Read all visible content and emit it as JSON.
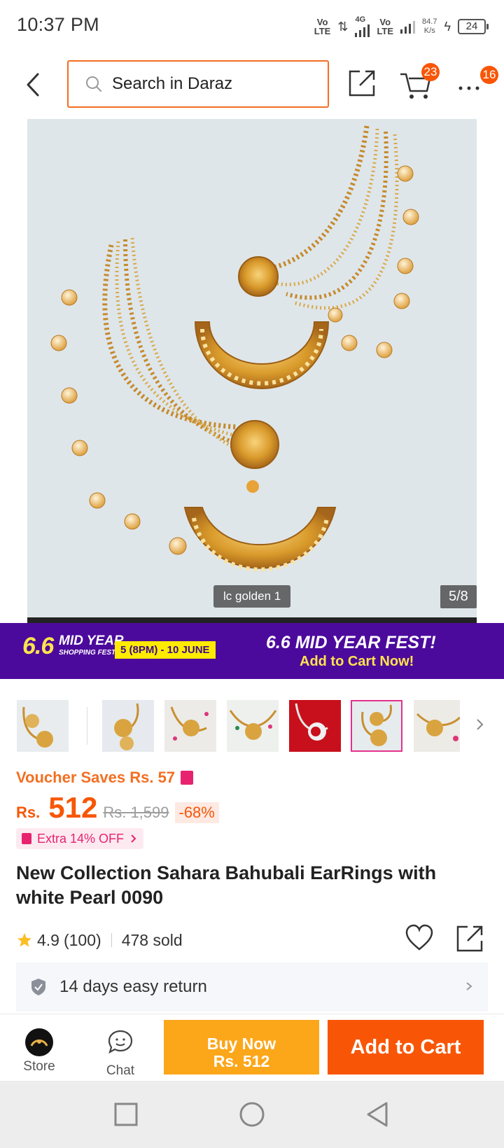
{
  "status_bar": {
    "time": "10:37 PM",
    "net1": "Vo\nLTE",
    "net2_gen": "4G",
    "net3": "Vo\nLTE",
    "speed_value": "84.7",
    "speed_unit": "K/s",
    "battery": "24"
  },
  "header": {
    "search_placeholder": "Search in Daraz",
    "cart_count": "23",
    "more_count": "16",
    "icons": [
      "back-arrow-icon",
      "search-icon",
      "share-icon",
      "cart-icon",
      "more-icon"
    ]
  },
  "gallery": {
    "caption": "lc golden 1",
    "counter": "5/8",
    "background": "#dfe6ea"
  },
  "banner": {
    "logo_number": "6.6",
    "logo_title": "MID YEAR",
    "logo_subtitle": "SHOPPING FEST!",
    "date": "5 (8PM) - 10 JUNE",
    "headline": "6.6 MID YEAR FEST!",
    "cta": "Add to Cart Now!",
    "background": "#4c0a9c"
  },
  "thumbnails": {
    "count": 7,
    "selected_index": 5,
    "backgrounds": [
      "#e8ecee",
      "#e6eaee",
      "#ecebe8",
      "#eef0ee",
      "#c8101c",
      "#e6ecee",
      "#ecebe6"
    ]
  },
  "product": {
    "voucher": "Voucher Saves Rs. 57",
    "currency": "Rs.",
    "price": "512",
    "original_price": "Rs. 1,599",
    "discount": "-68%",
    "extra_offer": "Extra 14% OFF",
    "title": "New Collection Sahara Bahubali EarRings with white Pearl 0090",
    "rating": "4.9",
    "reviews": "(100)",
    "sold": "478 sold",
    "return_policy": "14 days easy return"
  },
  "actions": {
    "store_label": "Store",
    "chat_label": "Chat",
    "buy_now_label": "Buy Now",
    "buy_now_price": "Rs. 512",
    "add_to_cart_label": "Add to Cart"
  },
  "colors": {
    "accent": "#f85606",
    "buy_now": "#fca61a",
    "pink": "#e7236f"
  }
}
